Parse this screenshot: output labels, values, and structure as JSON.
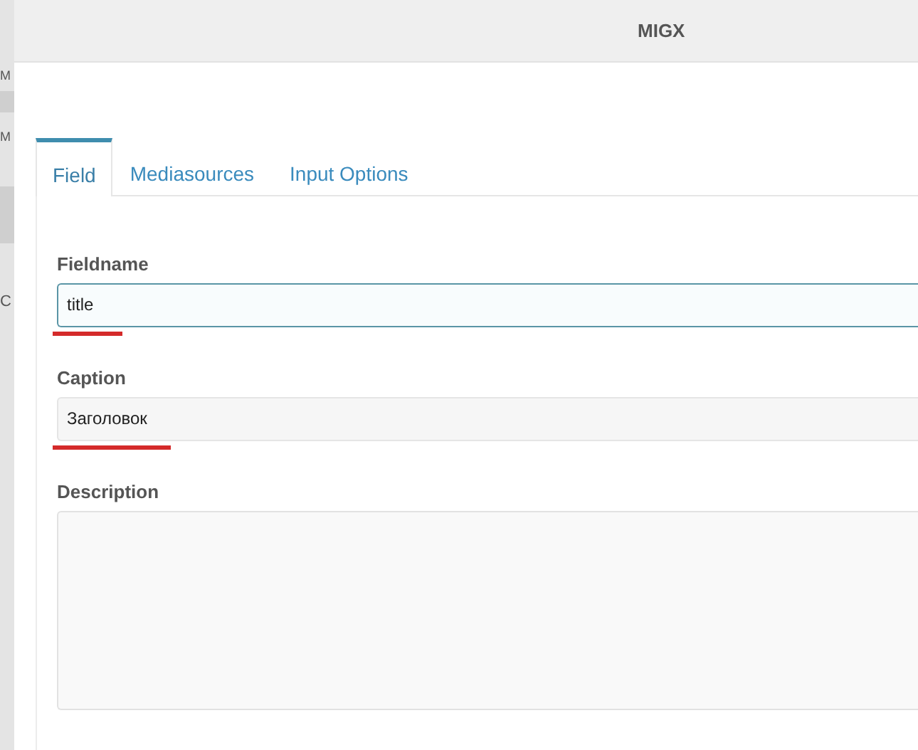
{
  "background": {
    "letters": [
      "M",
      "M",
      "C"
    ]
  },
  "window": {
    "title": "MIGX"
  },
  "tabs": [
    {
      "label": "Field",
      "selected": true
    },
    {
      "label": "Mediasources",
      "selected": false
    },
    {
      "label": "Input Options",
      "selected": false
    }
  ],
  "fields": [
    {
      "kind": "input",
      "label": "Fieldname",
      "value": "title",
      "focused": true,
      "underlined": true
    },
    {
      "kind": "input",
      "label": "Caption",
      "value": "Заголовок",
      "focused": false,
      "underlined": true
    },
    {
      "kind": "textarea",
      "label": "Description",
      "focused": false,
      "underlined": false
    }
  ]
}
